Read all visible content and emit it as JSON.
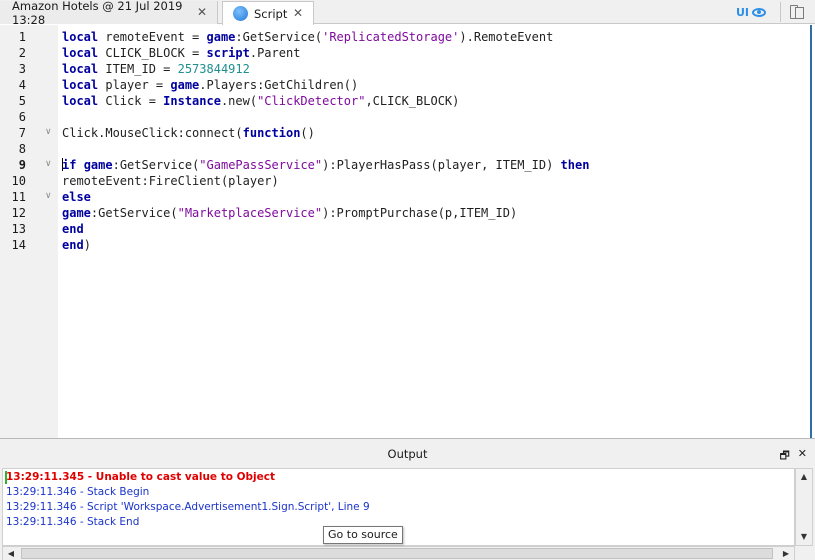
{
  "tabs": [
    {
      "label": "Amazon Hotels @ 21 Jul 2019 13:28",
      "close": "✕"
    },
    {
      "label": "Script",
      "close": "✕"
    }
  ],
  "toolbar": {
    "ui_label": "UI"
  },
  "editor": {
    "line_numbers": [
      "1",
      "2",
      "3",
      "4",
      "5",
      "6",
      "7",
      "8",
      "9",
      "10",
      "11",
      "12",
      "13",
      "14"
    ],
    "current_line": 9,
    "fold_markers": {
      "7": "∨",
      "9": "∨",
      "11": "∨"
    },
    "lines": [
      [
        {
          "t": "local",
          "c": "kw"
        },
        {
          "t": " remoteEvent = "
        },
        {
          "t": "game",
          "c": "kw"
        },
        {
          "t": ":GetService("
        },
        {
          "t": "'ReplicatedStorage'",
          "c": "str"
        },
        {
          "t": ").RemoteEvent"
        }
      ],
      [
        {
          "t": "local",
          "c": "kw"
        },
        {
          "t": " CLICK_BLOCK = "
        },
        {
          "t": "script",
          "c": "kw"
        },
        {
          "t": ".Parent"
        }
      ],
      [
        {
          "t": "local",
          "c": "kw"
        },
        {
          "t": " ITEM_ID = "
        },
        {
          "t": "2573844912",
          "c": "num"
        }
      ],
      [
        {
          "t": "local",
          "c": "kw"
        },
        {
          "t": " player = "
        },
        {
          "t": "game",
          "c": "kw"
        },
        {
          "t": ".Players:GetChildren()"
        }
      ],
      [
        {
          "t": "local",
          "c": "kw"
        },
        {
          "t": " Click = "
        },
        {
          "t": "Instance",
          "c": "kw"
        },
        {
          "t": ".new("
        },
        {
          "t": "\"ClickDetector\"",
          "c": "str"
        },
        {
          "t": ",CLICK_BLOCK)"
        }
      ],
      [],
      [
        {
          "t": "Click.MouseClick:connect("
        },
        {
          "t": "function",
          "c": "kw"
        },
        {
          "t": "()"
        }
      ],
      [],
      [
        {
          "t": "if",
          "c": "kw"
        },
        {
          "t": " "
        },
        {
          "t": "game",
          "c": "kw"
        },
        {
          "t": ":GetService("
        },
        {
          "t": "\"GamePassService\"",
          "c": "str"
        },
        {
          "t": "):PlayerHasPass(player, ITEM_ID) "
        },
        {
          "t": "then",
          "c": "kw"
        }
      ],
      [
        {
          "t": "remoteEvent:FireClient(player)"
        }
      ],
      [
        {
          "t": "else",
          "c": "kw"
        }
      ],
      [
        {
          "t": "game",
          "c": "kw"
        },
        {
          "t": ":GetService("
        },
        {
          "t": "\"MarketplaceService\"",
          "c": "str"
        },
        {
          "t": "):PromptPurchase(p,ITEM_ID)"
        }
      ],
      [
        {
          "t": "end",
          "c": "kw"
        }
      ],
      [
        {
          "t": "end",
          "c": "kw"
        },
        {
          "t": ")"
        }
      ]
    ]
  },
  "output": {
    "title": "Output",
    "logs": [
      {
        "text": "13:29:11.345 - Unable to cast value to Object",
        "type": "err"
      },
      {
        "text": "13:29:11.346 - Stack Begin",
        "type": "info"
      },
      {
        "text": "13:29:11.346 - Script 'Workspace.Advertisement1.Sign.Script', Line 9",
        "type": "info"
      },
      {
        "text": "13:29:11.346 - Stack End",
        "type": "info"
      }
    ],
    "tooltip": "Go to source",
    "restore_glyph": "🗗",
    "close_glyph": "✕"
  },
  "colors": {
    "keyword": "#00009f",
    "string": "#7f0a9e",
    "number": "#1f8f8f",
    "error": "#e00000",
    "info": "#1a33c9",
    "accent": "#2e8fe8"
  },
  "icons": {
    "script_tab": "globe-icon",
    "ui_toggle": "eye-icon",
    "device": "device-emulator-icon"
  }
}
